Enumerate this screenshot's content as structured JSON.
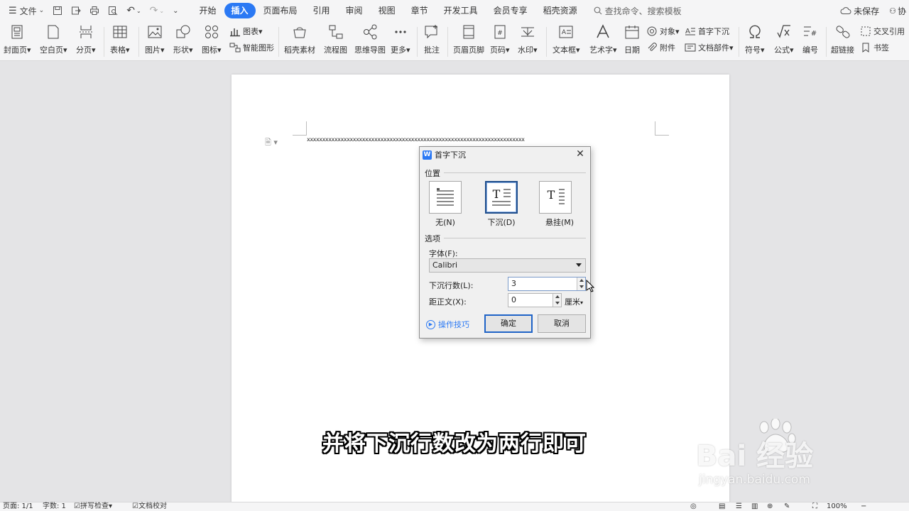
{
  "menubar": {
    "file_label": "文件",
    "tabs": [
      {
        "label": "开始",
        "active": false
      },
      {
        "label": "插入",
        "active": true
      },
      {
        "label": "页面布局",
        "active": false
      },
      {
        "label": "引用",
        "active": false
      },
      {
        "label": "审阅",
        "active": false
      },
      {
        "label": "视图",
        "active": false
      },
      {
        "label": "章节",
        "active": false
      },
      {
        "label": "开发工具",
        "active": false
      },
      {
        "label": "会员专享",
        "active": false
      },
      {
        "label": "稻壳资源",
        "active": false
      }
    ],
    "search_label": "查找命令、搜索模板",
    "unsaved_label": "未保存",
    "collab_label": "协",
    "accent_color": "#2b79f4"
  },
  "ribbon": {
    "buttons": [
      {
        "label": "封面页",
        "icon": "cover-page-icon"
      },
      {
        "label": "空白页",
        "icon": "blank-page-icon"
      },
      {
        "label": "分页",
        "icon": "page-break-icon"
      },
      {
        "label": "表格",
        "icon": "table-icon"
      },
      {
        "label": "图片",
        "icon": "picture-icon"
      },
      {
        "label": "形状",
        "icon": "shapes-icon"
      },
      {
        "label": "图标",
        "icon": "icons-icon"
      },
      {
        "label": "稻壳素材",
        "icon": "docer-material-icon"
      },
      {
        "label": "流程图",
        "icon": "flowchart-icon"
      },
      {
        "label": "思维导图",
        "icon": "mindmap-icon"
      },
      {
        "label": "更多",
        "icon": "more-icon"
      },
      {
        "label": "批注",
        "icon": "comment-icon"
      },
      {
        "label": "页眉页脚",
        "icon": "header-footer-icon"
      },
      {
        "label": "页码",
        "icon": "page-number-icon"
      },
      {
        "label": "水印",
        "icon": "watermark-icon"
      },
      {
        "label": "文本框",
        "icon": "textbox-icon"
      },
      {
        "label": "艺术字",
        "icon": "wordart-icon"
      },
      {
        "label": "日期",
        "icon": "date-icon"
      },
      {
        "label": "符号",
        "icon": "symbol-icon"
      },
      {
        "label": "公式",
        "icon": "formula-icon"
      },
      {
        "label": "编号",
        "icon": "numbering-icon"
      },
      {
        "label": "超链接",
        "icon": "hyperlink-icon"
      }
    ],
    "small_buttons": {
      "chart": "图表",
      "smart_graphic": "智能图形",
      "object": "对象",
      "attachment": "附件",
      "drop_cap": "首字下沉",
      "doc_parts": "文档部件",
      "cross_ref": "交叉引用",
      "bookmark": "书签"
    }
  },
  "document": {
    "text": "xxxxxxxxxxxxxxxxxxxxxxxxxxxxxxxxxxxxxxxxxxxxxxxxxxxxxxxxxxxxxxxxxxxxxxx"
  },
  "dialog": {
    "title": "首字下沉",
    "position_section": "位置",
    "positions": [
      {
        "label": "无(N)",
        "selected": false
      },
      {
        "label": "下沉(D)",
        "selected": true
      },
      {
        "label": "悬挂(M)",
        "selected": false
      }
    ],
    "options_section": "选项",
    "font_label": "字体(F):",
    "font_value": "Calibri",
    "lines_label": "下沉行数(L):",
    "lines_value": "3",
    "distance_label": "距正文(X):",
    "distance_value": "0",
    "distance_unit": "厘米",
    "tips_label": "操作技巧",
    "ok_label": "确定",
    "cancel_label": "取消"
  },
  "subtitle": "并将下沉行数改为两行即可",
  "watermark": {
    "brand": "Bai 经验",
    "url": "jingyan.baidu.com"
  },
  "statusbar": {
    "page": "页面: 1/1",
    "words": "字数: 1",
    "spellcheck": "拼写检查",
    "proofread": "文档校对",
    "zoom": "100%"
  }
}
